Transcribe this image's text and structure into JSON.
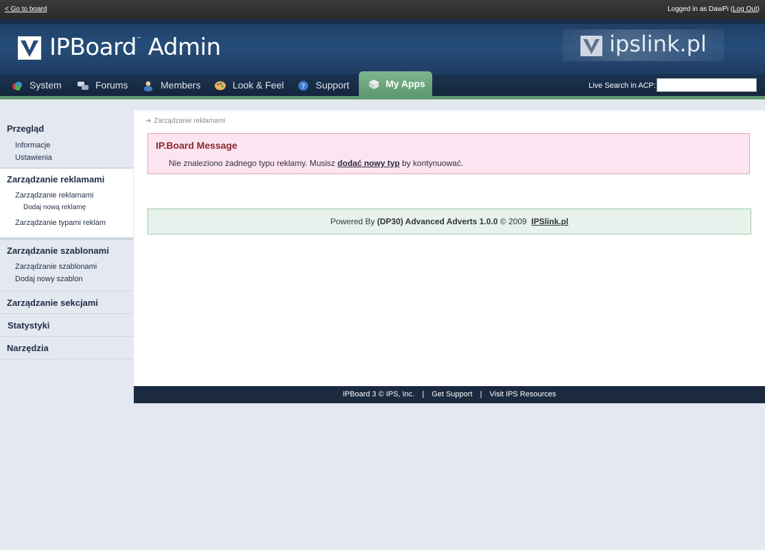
{
  "topbar": {
    "go_to_board": "< Go to board",
    "logged_in_prefix": "Logged in as",
    "username": "DawPi",
    "logout": "Log Out"
  },
  "header": {
    "logo_text": "IPBoard",
    "logo_tm": "™",
    "logo_admin": "Admin",
    "partner_text": "ipslink.pl"
  },
  "nav": {
    "tabs": [
      {
        "label": "System",
        "icon": "system-icon"
      },
      {
        "label": "Forums",
        "icon": "forums-icon"
      },
      {
        "label": "Members",
        "icon": "members-icon"
      },
      {
        "label": "Look & Feel",
        "icon": "look-feel-icon"
      },
      {
        "label": "Support",
        "icon": "support-icon"
      },
      {
        "label": "My Apps",
        "icon": "my-apps-icon",
        "active": true
      }
    ],
    "live_search_label": "Live Search in ACP:",
    "live_search_value": ""
  },
  "sidebar": {
    "sections": [
      {
        "title": "Przegląd",
        "items": [
          "Informacje",
          "Ustawienia"
        ]
      },
      {
        "title": "Zarządzanie reklamami",
        "items": [
          "Zarządzanie reklamami"
        ],
        "subitems": [
          "Dodaj nową reklamę"
        ],
        "items_after": [
          "Zarządzanie typami reklam"
        ]
      },
      {
        "title": "Zarządzanie szablonami",
        "items": [
          "Zarządzanie szablonami",
          "Dodaj nowy szablon"
        ]
      },
      {
        "title": "Zarządzanie sekcjami"
      },
      {
        "title": "Statystyki"
      },
      {
        "title": "Narzędzia"
      }
    ]
  },
  "main": {
    "breadcrumb": "Zarządzanie reklamami",
    "message_title": "IP.Board Message",
    "message_text_before": "Nie znaleziono żadnego typu reklamy. Musisz ",
    "message_link": "dodać nowy typ",
    "message_text_after": " by kontynuować.",
    "powered_prefix": "Powered By ",
    "powered_product": "(DP30) Advanced Adverts 1.0.0",
    "powered_middle": " © 2009  ",
    "powered_link": "IPSlink.pl"
  },
  "footer": {
    "copyright": "IPBoard 3 © IPS, Inc.",
    "get_support": "Get Support",
    "visit_resources": "Visit IPS Resources",
    "separator": "|"
  },
  "colors": {
    "header_bg": "#264d7a",
    "nav_active": "#6ea67f",
    "message_bg": "#fce4f0",
    "message_title": "#8a2830",
    "powered_bg": "#e6f2eb",
    "footer_bg": "#1b2a3f"
  }
}
